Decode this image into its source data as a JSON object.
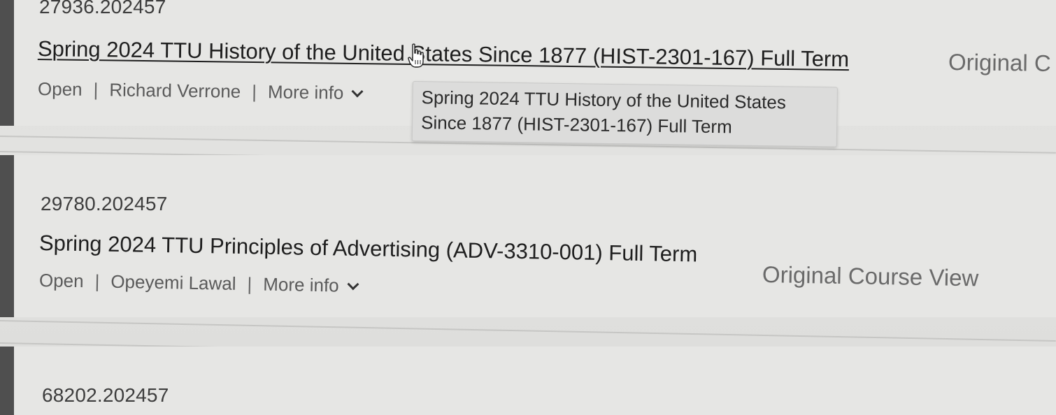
{
  "courses": [
    {
      "id": "27936.202457",
      "title": "Spring 2024 TTU History of the United States Since 1877 (HIST-2301-167) Full Term",
      "view_label": "Original C",
      "status": "Open",
      "instructor": "Richard Verrone",
      "more_info": "More info",
      "tooltip": "Spring 2024 TTU History of the United States Since 1877 (HIST-2301-167) Full Term"
    },
    {
      "id": "29780.202457",
      "title": "Spring 2024 TTU Principles of Advertising (ADV-3310-001) Full Term",
      "view_label": "Original Course View",
      "status": "Open",
      "instructor": "Opeyemi Lawal",
      "more_info": "More info"
    },
    {
      "id": "68202.202457"
    }
  ],
  "separator": "|",
  "icons": {
    "chevron": "chevron-down-icon",
    "cursor": "hand-pointer-icon"
  },
  "colors": {
    "card_bg": "#e6e6e4",
    "accent_bar": "#4f4f4f",
    "text_primary": "#1e1e1e",
    "text_secondary": "#5a5a5a"
  }
}
